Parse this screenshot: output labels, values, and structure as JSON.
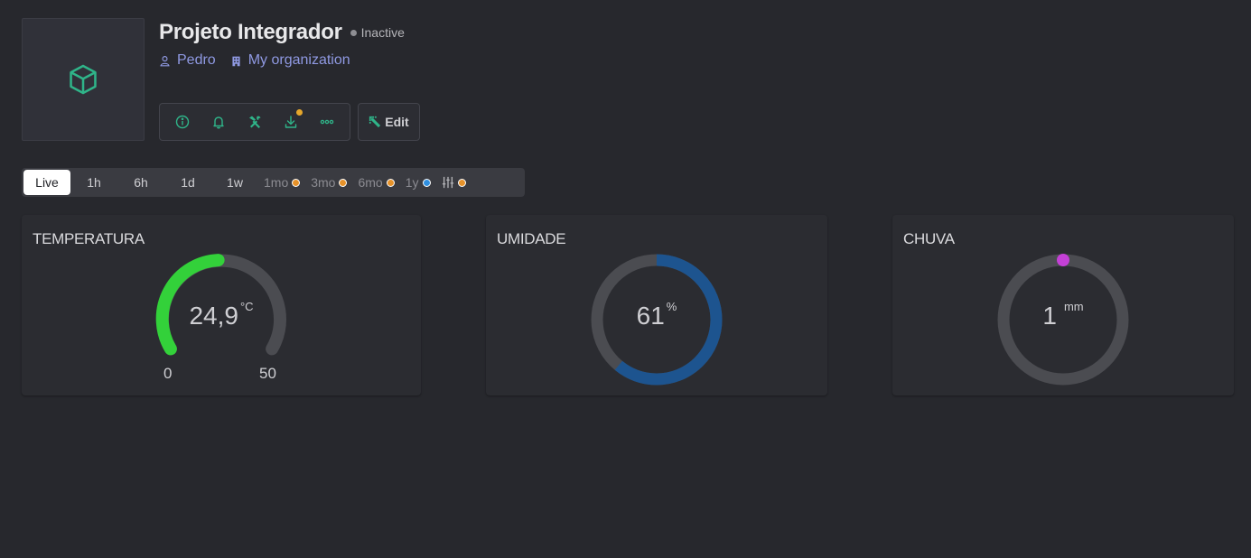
{
  "header": {
    "title": "Projeto Integrador",
    "status": "Inactive",
    "owner": "Pedro",
    "organization": "My organization",
    "thumbnail_icon": "cube-icon",
    "accent": "#2fb489",
    "actions": [
      "info-icon",
      "bell-icon",
      "tools-icon",
      "download-icon",
      "more-icon"
    ],
    "edit_label": "Edit"
  },
  "timebar": {
    "items": [
      {
        "label": "Live",
        "selected": true
      },
      {
        "label": "1h"
      },
      {
        "label": "6h"
      },
      {
        "label": "1d"
      },
      {
        "label": "1w"
      },
      {
        "label": "1mo",
        "badge": "#e6922a"
      },
      {
        "label": "3mo",
        "badge": "#e6922a"
      },
      {
        "label": "6mo",
        "badge": "#e6922a"
      },
      {
        "label": "1y",
        "badge": "#2f8fe0"
      }
    ],
    "filter_badge": "#e6922a"
  },
  "widgets": {
    "temperatura": {
      "title": "TEMPERATURA",
      "value": "24,9",
      "unit": "°C",
      "min": "0",
      "max": "50",
      "color": "#33d13a"
    },
    "umidade": {
      "title": "UMIDADE",
      "value": "61",
      "unit": "%",
      "color": "#1d548f"
    },
    "chuva": {
      "title": "CHUVA",
      "value": "1",
      "unit": "mm",
      "color": "#c440d6"
    }
  }
}
